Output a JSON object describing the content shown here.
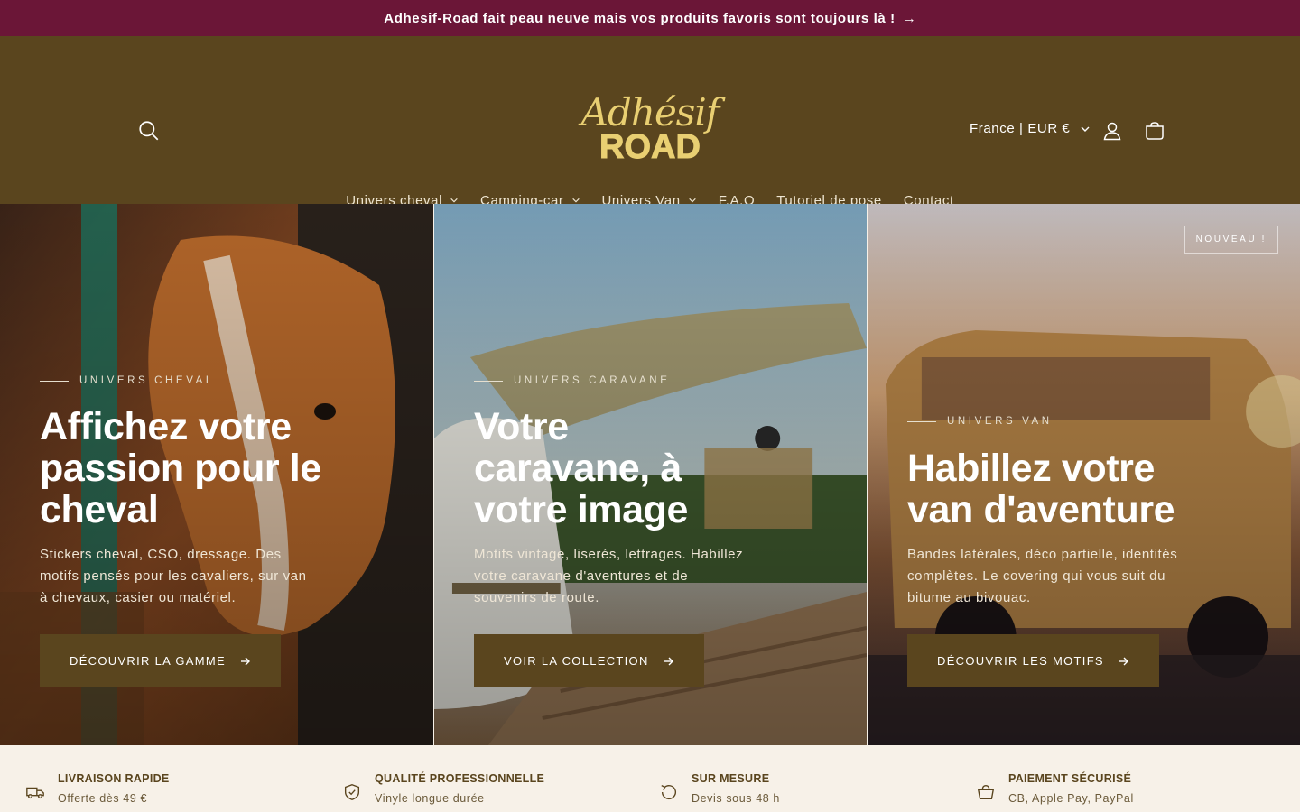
{
  "announcement": {
    "text": "Adhesif-Road fait peau neuve mais vos produits favoris sont toujours là !",
    "arrow": "→"
  },
  "header": {
    "logo_script": "Adhésif",
    "logo_wordmark": "ROAD",
    "region_label": "France | EUR €",
    "icons": [
      "search-icon",
      "account-icon",
      "cart-icon"
    ]
  },
  "nav": {
    "items": [
      {
        "label": "Univers cheval",
        "has_dropdown": true
      },
      {
        "label": "Camping-car",
        "has_dropdown": true
      },
      {
        "label": "Univers Van",
        "has_dropdown": true
      },
      {
        "label": "F.A.Q",
        "has_dropdown": false
      },
      {
        "label": "Tutoriel de pose",
        "has_dropdown": false
      },
      {
        "label": "Contact",
        "has_dropdown": false
      }
    ]
  },
  "hero": {
    "panels": [
      {
        "eyebrow": "UNIVERS CHEVAL",
        "title": "Affichez votre passion pour le cheval",
        "description": "Stickers cheval, CSO, dressage. Des motifs pensés pour les cavaliers, sur van à chevaux, casier ou matériel.",
        "cta": "DÉCOUVRIR LA GAMME"
      },
      {
        "eyebrow": "UNIVERS CARAVANE",
        "title": "Votre caravane, à votre image",
        "description": "Motifs vintage, liserés, lettrages. Habillez votre caravane d'aventures et de souvenirs de route.",
        "cta": "VOIR LA COLLECTION"
      },
      {
        "badge": "NOUVEAU !",
        "eyebrow": "UNIVERS VAN",
        "title": "Habillez votre van d'aventure",
        "description": "Bandes latérales, déco partielle, identités complètes. Le covering qui vous suit du bitume au bivouac.",
        "cta": "DÉCOUVRIR LES MOTIFS"
      }
    ]
  },
  "features": [
    {
      "icon": "truck-icon",
      "title": "LIVRAISON RAPIDE",
      "subtitle": "Offerte dès 49 €"
    },
    {
      "icon": "shield-check-icon",
      "title": "QUALITÉ PROFESSIONNELLE",
      "subtitle": "Vinyle longue durée"
    },
    {
      "icon": "refresh-icon",
      "title": "SUR MESURE",
      "subtitle": "Devis sous 48 h"
    },
    {
      "icon": "shopping-bag-icon",
      "title": "PAIEMENT SÉCURISÉ",
      "subtitle": "CB, Apple Pay, PayPal"
    }
  ],
  "colors": {
    "announcement_bg": "#6b1637",
    "header_bg": "#5a451e",
    "logo": "#e9cf72",
    "features_bg": "#f7f1e8"
  }
}
